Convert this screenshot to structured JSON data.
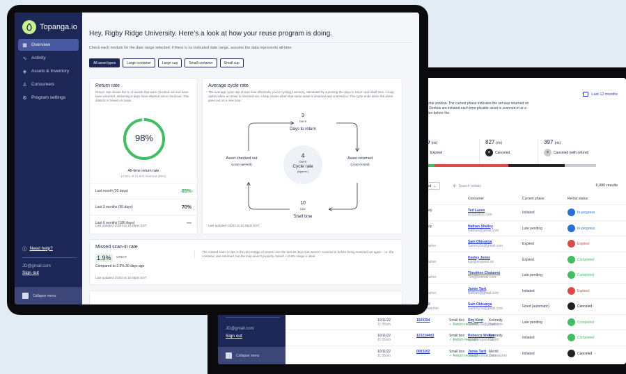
{
  "brand": {
    "name": "Topanga.io"
  },
  "sidebar": {
    "items": [
      {
        "label": "Overview",
        "icon": "grid-icon"
      },
      {
        "label": "Activity",
        "icon": "pulse-icon"
      },
      {
        "label": "Assets & Inventory",
        "icon": "layers-icon"
      },
      {
        "label": "Consumers",
        "icon": "user-icon"
      },
      {
        "label": "Program settings",
        "icon": "gear-icon"
      }
    ],
    "help": "Need help?",
    "email": "JD@gmail.com",
    "signout": "Sign out",
    "collapse": "Collapse menu"
  },
  "main": {
    "title": "Hey, Rigby Ridge University. Here’s a look at how your reuse program is doing.",
    "subtitle": "Check each module for the date range selected; if there is no indicated date range, assume the data represents all-time.",
    "filters": [
      "All asset types",
      "Large container",
      "Large cup",
      "Small container",
      "Small cup"
    ]
  },
  "return_rate": {
    "title": "Return rate",
    "desc": "Return rate shows the % of assets that were checked out and have been returned, assuming 5 days have elapsed since checkout. This statistic is based on loops.",
    "value": "98%",
    "fraction": 0.98,
    "label": "All-time return rate",
    "detail": "12,621 of 12,870 returned (98%)",
    "rows": [
      {
        "label": "Last month (30 days)",
        "value": "85%"
      },
      {
        "label": "Last 3 months (90 days)",
        "value": "70%"
      },
      {
        "label": "Last 6 months (180 days)",
        "value": "—"
      }
    ],
    "updated": "Last updated 1/3/23 at 10:45pm EST"
  },
  "cycle_rate": {
    "title": "Average cycle rate",
    "desc": "The average cycle rate shows how effectively you’re cycling inventory, calculated by summing the days to return and shelf time. A loop opens when an asset is checked-out; a loop closes when that same asset is returned and scanned in. The cycle ends when the asset goes out on a new loop.",
    "top_num": "3",
    "top_unit": "DAYS",
    "top_label": "Days to return",
    "left_label": "Asset checked out",
    "left_sub": "(Loop opened)",
    "right_label": "Asset returned",
    "right_sub": "(Loop closed)",
    "center_num": "4",
    "center_unit": "DAYS",
    "center_label": "Cycle rate",
    "center_sub": "(Approx.)",
    "bottom_num": "10",
    "bottom_unit": "DAY",
    "bottom_label": "Shelf time",
    "updated": "Last updated 1/3/23 at 10:45pm EST"
  },
  "missed": {
    "title": "Missed scan-in rate",
    "value": "1.9%",
    "grade": "GREAT",
    "compare": "Compared to 3.5% 30 days ago",
    "desc": "The missed scan-in rate is the percentage of assets over the last 30 days that weren’t scanned in before being scanned out again - i.e. the container was returned, but the loop wasn’t properly closed. A 0-8% range is ideal.",
    "updated": "Last updated 1/3/23 at 10:45pm EST"
  },
  "back": {
    "date_range": "Last 12 months",
    "desc": "ed rental window. The current phase indicates the set was returned on time. Rentals are initiated each time plicable asset is scanned-in at a location before the",
    "stats": [
      {
        "value": "769",
        "unit": "(ris)",
        "label": "Expired"
      },
      {
        "value": "827",
        "unit": "(ris)",
        "label": "Canceled"
      },
      {
        "value": "397",
        "unit": "(ris)",
        "label": "Canceled (with refund)"
      }
    ],
    "search_placeholder": "Search rentals",
    "filter_label": "ived",
    "results": "6,000 results",
    "headers": [
      "ation",
      "Consumer",
      "Current phase",
      "Rental status"
    ],
    "rows": [
      {
        "loc": "ennedy",
        "loc2": "astor",
        "name": "Ted Lasso",
        "email": "ted@stlest.com",
        "phase": "Initiated",
        "status": "In-progress",
        "color": "#2a6fd6"
      },
      {
        "loc": "ennedy",
        "loc2": "astor",
        "name": "Nathan Shelley",
        "email": "Nathan@gmail.com",
        "phase": "Late pending",
        "status": "In-progress",
        "color": "#2a6fd6"
      },
      {
        "loc": "errill",
        "loc2": "ishwasher",
        "name": "Sam Obisanya",
        "email": "Sammy3x@gmail.com",
        "phase": "Expired",
        "status": "Expired",
        "color": "#e04848"
      },
      {
        "loc": "errill",
        "loc2": "ishwasher",
        "name": "Keeley Jones",
        "email": "kjjo@england.uk",
        "phase": "Expired",
        "status": "Completed",
        "color": "#3fbf62"
      },
      {
        "loc": "errill",
        "loc2": "ishwasher",
        "name": "Timothee Chalamet",
        "email": "Tim@hotmail.com",
        "phase": "Late pending",
        "status": "Completed",
        "color": "#3fbf62"
      },
      {
        "loc": "errill",
        "loc2": "ishwasher",
        "name": "Jamie Tartt",
        "email": "Nathan@gmail.com",
        "phase": "Initiated",
        "status": "Expired",
        "color": "#e04848"
      },
      {
        "loc": "Merrill",
        "loc2": "Dishwasher",
        "name": "Sam Obisanya",
        "email": "Sammy3x@gmail.com",
        "phase": "Fined (automatic)",
        "status": "Canceled",
        "color": "#222"
      },
      {
        "date": "10/11/22",
        "time": "11:05am",
        "id": "1020394",
        "asset": "Small box",
        "ret": "✓ Return received",
        "loc": "Kennedy",
        "loc2": "Castor",
        "name": "Roy Kent",
        "email": "Sammy3x@gmail.com",
        "phase": "Late pending",
        "status": "Completed",
        "color": "#3fbf62"
      },
      {
        "date": "10/11/22",
        "time": "11:05am",
        "id": "1232144d3",
        "asset": "Small box",
        "ret": "✓ Return received",
        "loc": "Kennedy",
        "loc2": "Castor",
        "name": "Rebecca Welton",
        "email": "kjjo@england.uk",
        "phase": "Initiated",
        "status": "Completed",
        "color": "#3fbf62"
      },
      {
        "date": "10/11/22",
        "time": "11:05am",
        "id": "0003102",
        "asset": "Small box",
        "ret": "✓ Return received",
        "loc": "Merrill",
        "loc2": "Dishwasher",
        "name": "Jamie Tartt",
        "email": "Tim@hotmail.com",
        "phase": "Initiated",
        "status": "Canceled",
        "color": "#222"
      }
    ]
  }
}
